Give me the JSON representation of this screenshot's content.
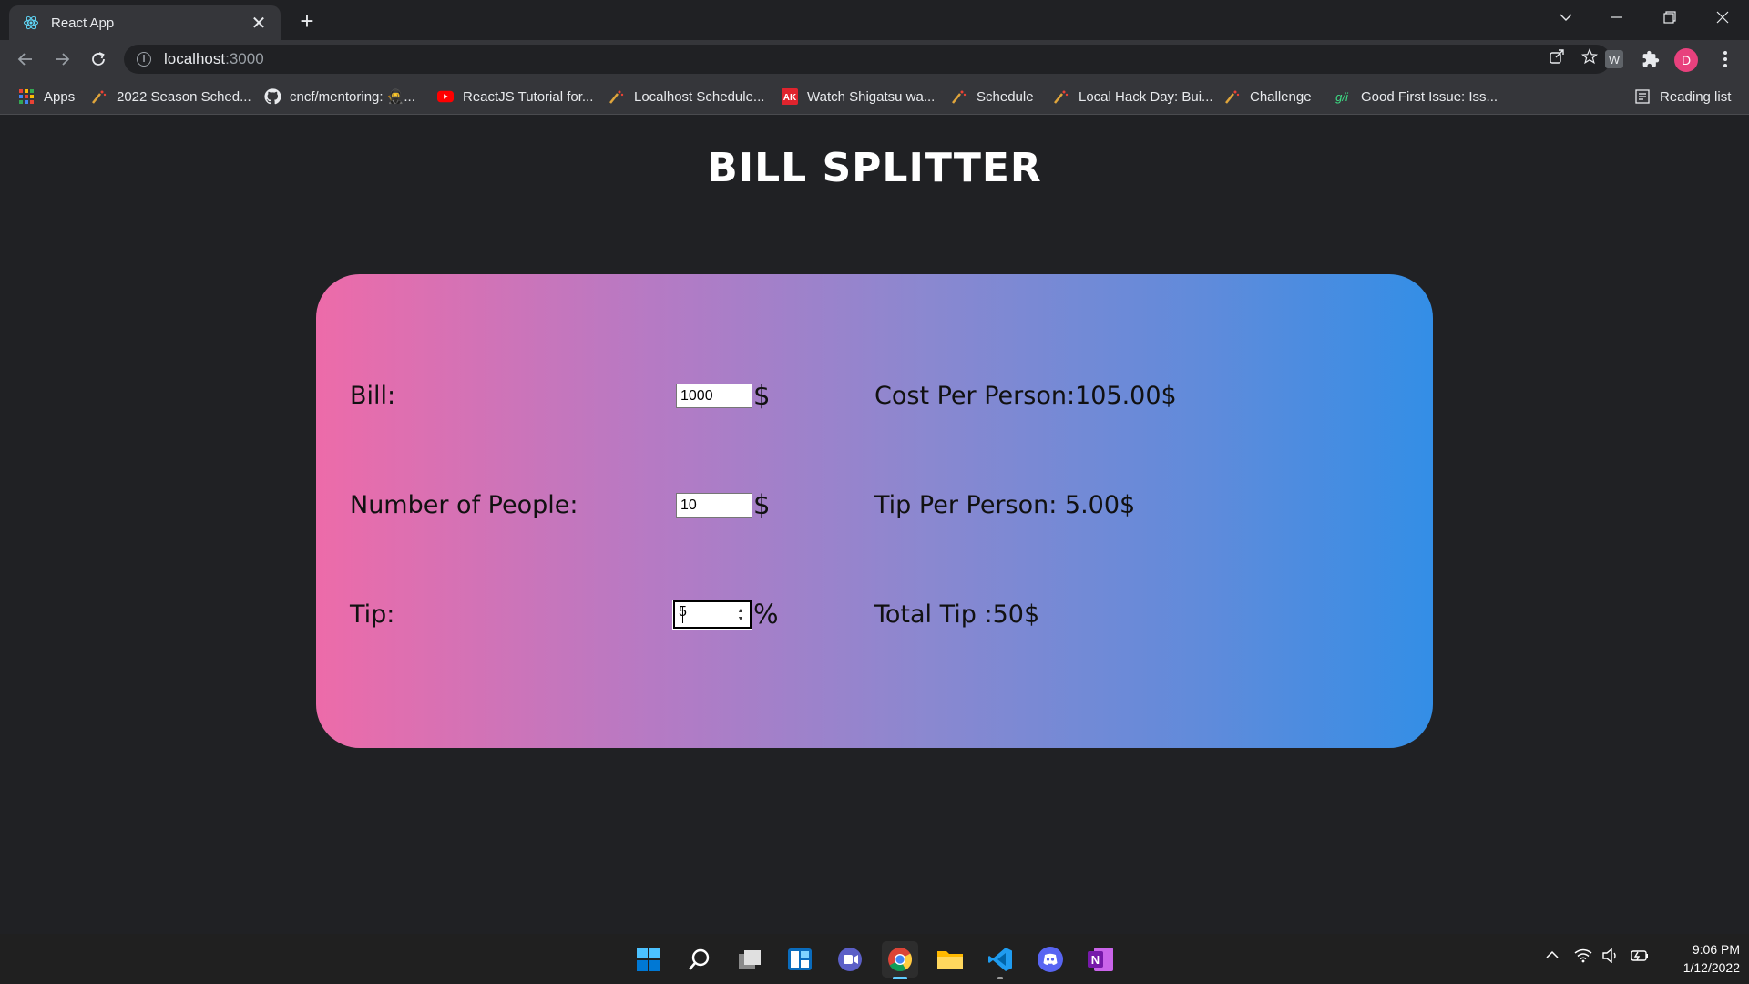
{
  "browser": {
    "tab": {
      "title": "React App",
      "favicon": "react-logo-icon"
    },
    "address": {
      "host": "localhost",
      "port": ":3000"
    },
    "profile_initial": "D",
    "extension_w": "W",
    "bookmarks": [
      {
        "label": "Apps",
        "icon": "apps-grid-icon"
      },
      {
        "label": "2022 Season Sched...",
        "icon": "devpost-icon"
      },
      {
        "label": "cncf/mentoring: 🥷...",
        "icon": "github-icon"
      },
      {
        "label": "ReactJS Tutorial for...",
        "icon": "youtube-icon"
      },
      {
        "label": "Localhost Schedule...",
        "icon": "devpost-icon"
      },
      {
        "label": "Watch Shigatsu wa...",
        "icon": "anime-site-icon"
      },
      {
        "label": "Schedule",
        "icon": "devpost-icon"
      },
      {
        "label": "Local Hack Day: Bui...",
        "icon": "devpost-icon"
      },
      {
        "label": "Challenge",
        "icon": "devpost-icon"
      },
      {
        "label": "Good First Issue: Iss...",
        "icon": "gfi-icon",
        "icon_text": "g/i"
      }
    ],
    "reading_list": "Reading list"
  },
  "app": {
    "title": "BILL SPLITTER",
    "rows": [
      {
        "label": "Bill:",
        "input_value": "1000",
        "unit": "$",
        "result": "Cost Per Person:105.00$"
      },
      {
        "label": "Number of People:",
        "input_value": "10",
        "unit": "$",
        "result": "Tip Per Person: 5.00$"
      },
      {
        "label": "Tip:",
        "input_value": "5",
        "unit": "%",
        "result": "Total Tip :50$"
      }
    ],
    "colors": {
      "gradient_start": "#ed6ba9",
      "gradient_end": "#338ee6",
      "background": "#202124"
    }
  },
  "taskbar": {
    "apps": [
      "windows-start-icon",
      "search-icon",
      "task-view-icon",
      "widgets-icon",
      "teams-chat-icon",
      "chrome-icon",
      "file-explorer-icon",
      "vscode-icon",
      "discord-icon",
      "onenote-icon"
    ],
    "time": "9:06 PM",
    "date": "1/12/2022"
  }
}
